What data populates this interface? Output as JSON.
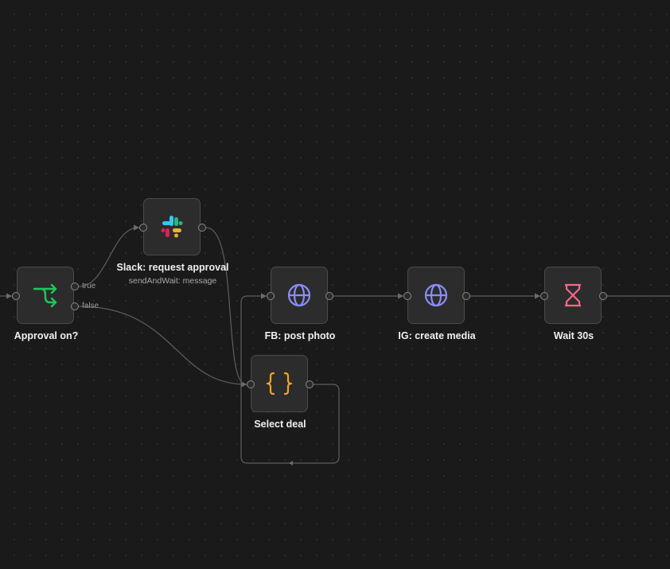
{
  "nodes": {
    "approval": {
      "label": "Approval on?",
      "true_label": "true",
      "false_label": "false",
      "icon": "branch-icon",
      "color": "#22c55e"
    },
    "slack": {
      "label": "Slack: request approval",
      "sublabel": "sendAndWait: message",
      "icon": "slack-icon"
    },
    "fb": {
      "label": "FB: post photo",
      "icon": "globe-icon",
      "color": "#8b8cf8"
    },
    "ig": {
      "label": "IG: create media",
      "icon": "globe-icon",
      "color": "#8b8cf8"
    },
    "wait": {
      "label": "Wait 30s",
      "icon": "hourglass-icon",
      "color": "#f06a8a"
    },
    "select": {
      "label": "Select deal",
      "icon": "braces-icon",
      "color": "#f5a623"
    }
  },
  "colors": {
    "canvas": "#1a1a1a",
    "node_bg": "#2c2c2c",
    "edge": "#5e5e5e"
  }
}
